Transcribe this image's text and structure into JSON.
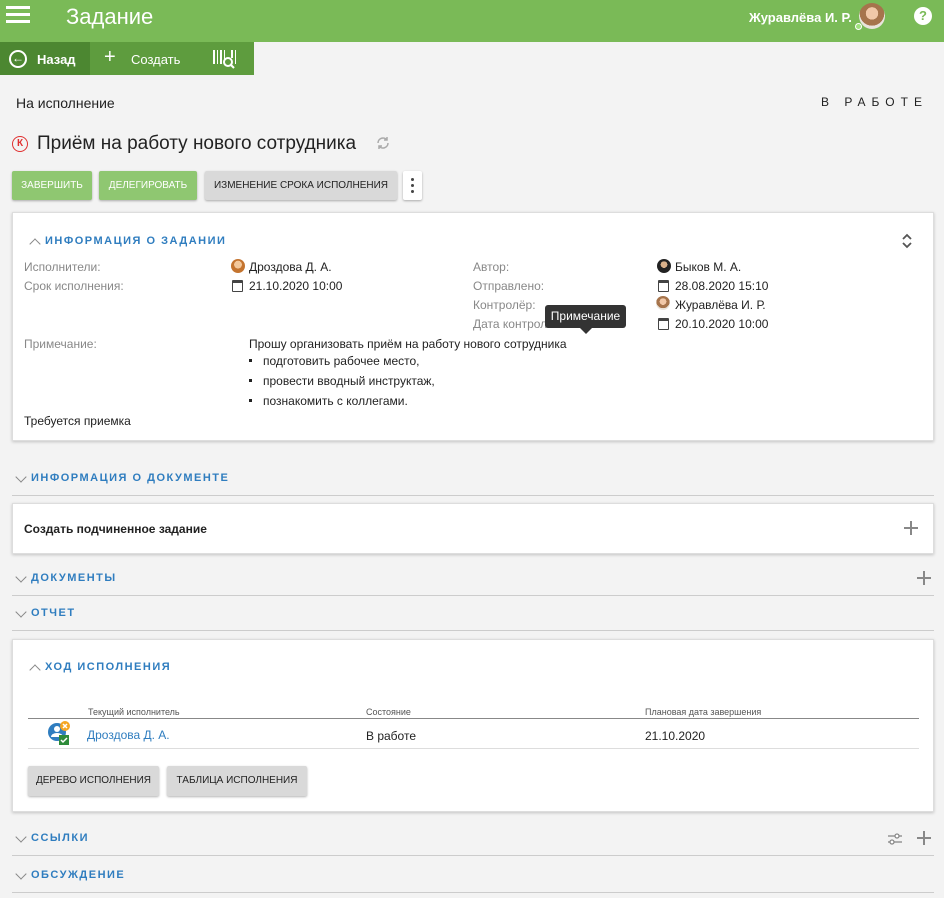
{
  "header": {
    "title": "Задание",
    "user": "Журавлёва И. Р.",
    "help": "?"
  },
  "toolbar": {
    "back": "Назад",
    "create": "Создать"
  },
  "task": {
    "status_left": "На исполнение",
    "status_right": "В РАБОТЕ",
    "badge": "К",
    "title": "Приём на работу нового сотрудника"
  },
  "actions": [
    "Завершить",
    "Делегировать",
    "Изменение срока исполнения"
  ],
  "info": {
    "title": "Информация о задании",
    "executors_label": "Исполнители:",
    "executors": "Дроздова Д. А.",
    "deadline_label": "Срок исполнения:",
    "deadline": "21.10.2020 10:00",
    "author_label": "Автор:",
    "author": "Быков М. А.",
    "sent_label": "Отправлено:",
    "sent": "28.08.2020 15:10",
    "controller_label": "Контролёр:",
    "controller": "Журавлёва И. Р.",
    "control_date_label": "Дата контроля:",
    "control_date": "20.10.2020 10:00",
    "note_label": "Примечание:",
    "note_text": "Прошу организовать приём на работу нового сотрудника",
    "note_items": [
      "подготовить рабочее место,",
      "провести вводный инструктаж,",
      "познакомить с коллегами."
    ],
    "acceptance": "Требуется приемка",
    "tooltip": "Примечание"
  },
  "sections": {
    "doc_info": "Информация о документе",
    "create_subtask": "Создать подчиненное задание",
    "documents": "Документы",
    "report": "Отчет",
    "progress": "Ход исполнения",
    "links": "Ссылки",
    "discussion": "Обсуждение"
  },
  "progress_table": {
    "headers": [
      "Текущий исполнитель",
      "Состояние",
      "Плановая дата завершения"
    ],
    "rows": [
      {
        "executor": "Дроздова Д. А.",
        "state": "В работе",
        "date": "21.10.2020"
      }
    ],
    "buttons": [
      "Дерево исполнения",
      "Таблица исполнения"
    ]
  },
  "colors": {
    "header": "#7aba57",
    "accent": "#2f7dbf",
    "button": "#8fc771"
  }
}
